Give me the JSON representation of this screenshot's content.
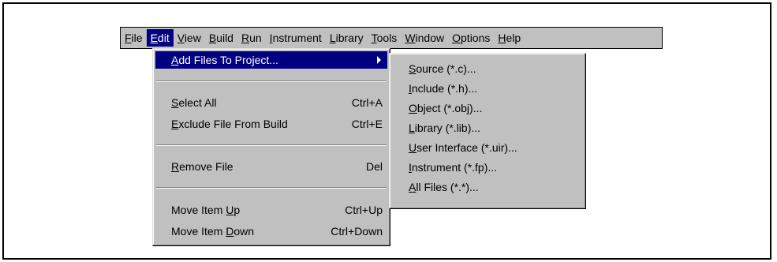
{
  "menubar": {
    "items": [
      {
        "pre": "",
        "key": "F",
        "post": "ile"
      },
      {
        "pre": "",
        "key": "E",
        "post": "dit"
      },
      {
        "pre": "",
        "key": "V",
        "post": "iew"
      },
      {
        "pre": "",
        "key": "B",
        "post": "uild"
      },
      {
        "pre": "",
        "key": "R",
        "post": "un"
      },
      {
        "pre": "",
        "key": "I",
        "post": "nstrument"
      },
      {
        "pre": "",
        "key": "L",
        "post": "ibrary"
      },
      {
        "pre": "",
        "key": "T",
        "post": "ools"
      },
      {
        "pre": "",
        "key": "W",
        "post": "indow"
      },
      {
        "pre": "",
        "key": "O",
        "post": "ptions"
      },
      {
        "pre": "",
        "key": "H",
        "post": "elp"
      }
    ]
  },
  "edit_menu": {
    "add_files": {
      "pre": "",
      "key": "A",
      "post": "dd Files To Project..."
    },
    "select_all": {
      "pre": "",
      "key": "S",
      "post": "elect All",
      "shortcut": "Ctrl+A"
    },
    "exclude": {
      "pre": "",
      "key": "E",
      "post": "xclude File From Build",
      "shortcut": "Ctrl+E"
    },
    "remove": {
      "pre": "",
      "key": "R",
      "post": "emove File",
      "shortcut": "Del"
    },
    "move_up": {
      "pre": "Move Item ",
      "key": "U",
      "post": "p",
      "shortcut": "Ctrl+Up"
    },
    "move_down": {
      "pre": "Move Item ",
      "key": "D",
      "post": "own",
      "shortcut": "Ctrl+Down"
    }
  },
  "submenu": {
    "items": [
      {
        "pre": "",
        "key": "S",
        "post": "ource (*.c)..."
      },
      {
        "pre": "",
        "key": "I",
        "post": "nclude (*.h)..."
      },
      {
        "pre": "",
        "key": "O",
        "post": "bject (*.obj)..."
      },
      {
        "pre": "",
        "key": "L",
        "post": "ibrary (*.lib)..."
      },
      {
        "pre": "",
        "key": "U",
        "post": "ser Interface (*.uir)..."
      },
      {
        "pre": "",
        "key": "I",
        "post": "nstrument (*.fp)..."
      },
      {
        "pre": "",
        "key": "A",
        "post": "ll Files (*.*)..."
      }
    ]
  }
}
